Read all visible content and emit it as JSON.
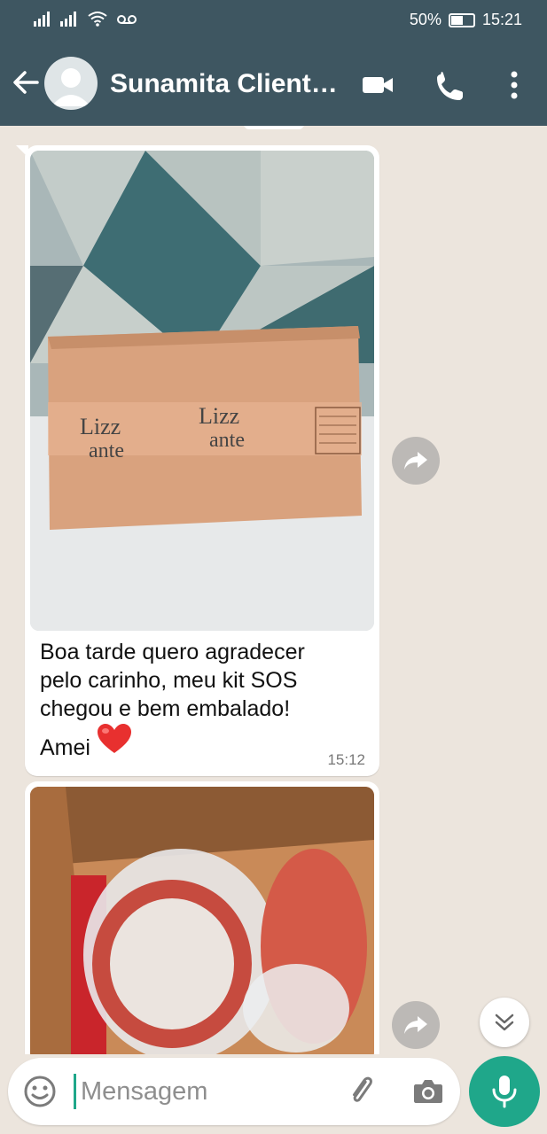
{
  "status_bar": {
    "battery": "50%",
    "time": "15:21",
    "battery_level": 0.5
  },
  "header": {
    "title": "Sunamita Cliente…"
  },
  "messages": [
    {
      "image": "cardboard-box-photo",
      "lines": [
        "Boa tarde quero agradecer",
        "pelo carinho, meu kit SOS",
        "chegou e bem embalado!"
      ],
      "last_line": "Amei",
      "emoji": "❤️",
      "time": "15:12"
    },
    {
      "image": "open-box-products-photo"
    }
  ],
  "composer": {
    "placeholder": "Mensagem"
  },
  "colors": {
    "header": "#3e5661",
    "chat_bg": "#ece5dd",
    "accent": "#1fa78a"
  }
}
